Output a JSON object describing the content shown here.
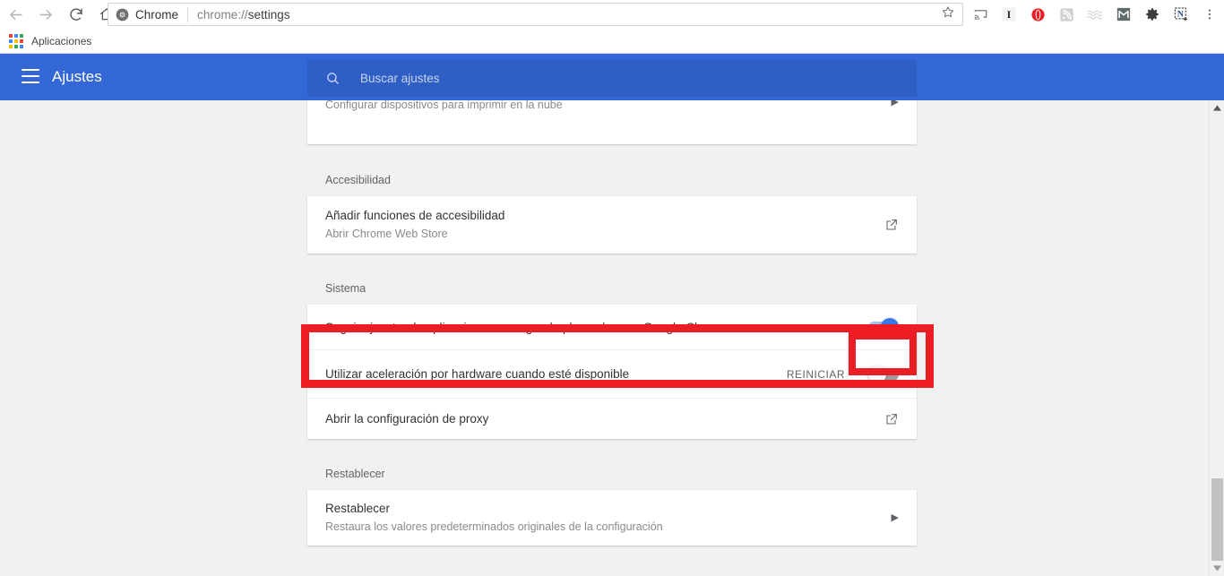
{
  "browser": {
    "nav": {
      "back_icon": "arrow-left-icon",
      "forward_icon": "arrow-right-icon",
      "reload_icon": "reload-icon",
      "home_icon": "home-icon"
    },
    "omnibox": {
      "site_icon": "chrome-logo-icon",
      "site_label": "Chrome",
      "url_prefix": "chrome://",
      "url_page": "settings",
      "url_full": "chrome://settings",
      "star_icon": "bookmark-star-icon"
    },
    "toolbar_icons": [
      {
        "name": "cast-icon",
        "label": "Cast"
      },
      {
        "name": "instapaper-icon",
        "label": "I"
      },
      {
        "name": "opera-red-circle-icon",
        "label": "O"
      },
      {
        "name": "rss-feed-icon",
        "label": "RSS"
      },
      {
        "name": "wave-lines-icon",
        "label": "Waves"
      },
      {
        "name": "gmail-m-icon",
        "label": "M"
      },
      {
        "name": "gear-icon",
        "label": "Settings extension"
      },
      {
        "name": "evernote-n-icon",
        "label": "N"
      },
      {
        "name": "chrome-menu-icon",
        "label": "More"
      }
    ],
    "bookmarks": {
      "apps_icon": "apps-grid-icon",
      "apps_label": "Aplicaciones"
    }
  },
  "settings": {
    "menu_icon": "hamburger-menu-icon",
    "title": "Ajustes",
    "search": {
      "icon": "search-icon",
      "placeholder": "Buscar ajustes",
      "value": ""
    }
  },
  "content": {
    "partial_card": {
      "subtitle": "Configurar dispositivos para imprimir en la nube",
      "arrow_icon": "chevron-right-icon"
    },
    "sections": [
      {
        "label": "Accesibilidad",
        "rows": [
          {
            "title": "Añadir funciones de accesibilidad",
            "subtitle": "Abrir Chrome Web Store",
            "control": "external-link",
            "icon": "external-link-icon"
          }
        ]
      },
      {
        "label": "Sistema",
        "rows": [
          {
            "title": "Seguir ejecutando aplicaciones en segundo plano al cerrar Google Chrome",
            "subtitle": "",
            "control": "toggle",
            "toggle_state": "on"
          },
          {
            "title": "Utilizar aceleración por hardware cuando esté disponible",
            "subtitle": "",
            "control": "toggle",
            "toggle_state": "off",
            "action_label": "REINICIAR"
          },
          {
            "title": "Abrir la configuración de proxy",
            "subtitle": "",
            "control": "external-link",
            "icon": "external-link-icon"
          }
        ]
      },
      {
        "label": "Restablecer",
        "rows": [
          {
            "title": "Restablecer",
            "subtitle": "Restaura los valores predeterminados originales de la configuración",
            "control": "arrow",
            "icon": "chevron-right-icon"
          }
        ]
      }
    ]
  },
  "annotations": {
    "outer_rect_name": "highlight-hardware-acceleration-row",
    "inner_rect_name": "highlight-hardware-acceleration-toggle",
    "color": "#ee1c23"
  },
  "scrollbar": {
    "up_icon": "scroll-up-arrow-icon",
    "down_icon": "scroll-down-arrow-icon",
    "thumb_name": "scrollbar-thumb"
  },
  "colors": {
    "header_blue": "#3367d6",
    "search_blue": "#2f5fc4",
    "toggle_on": "#3b78e7",
    "page_bg": "#f1f1f1"
  }
}
